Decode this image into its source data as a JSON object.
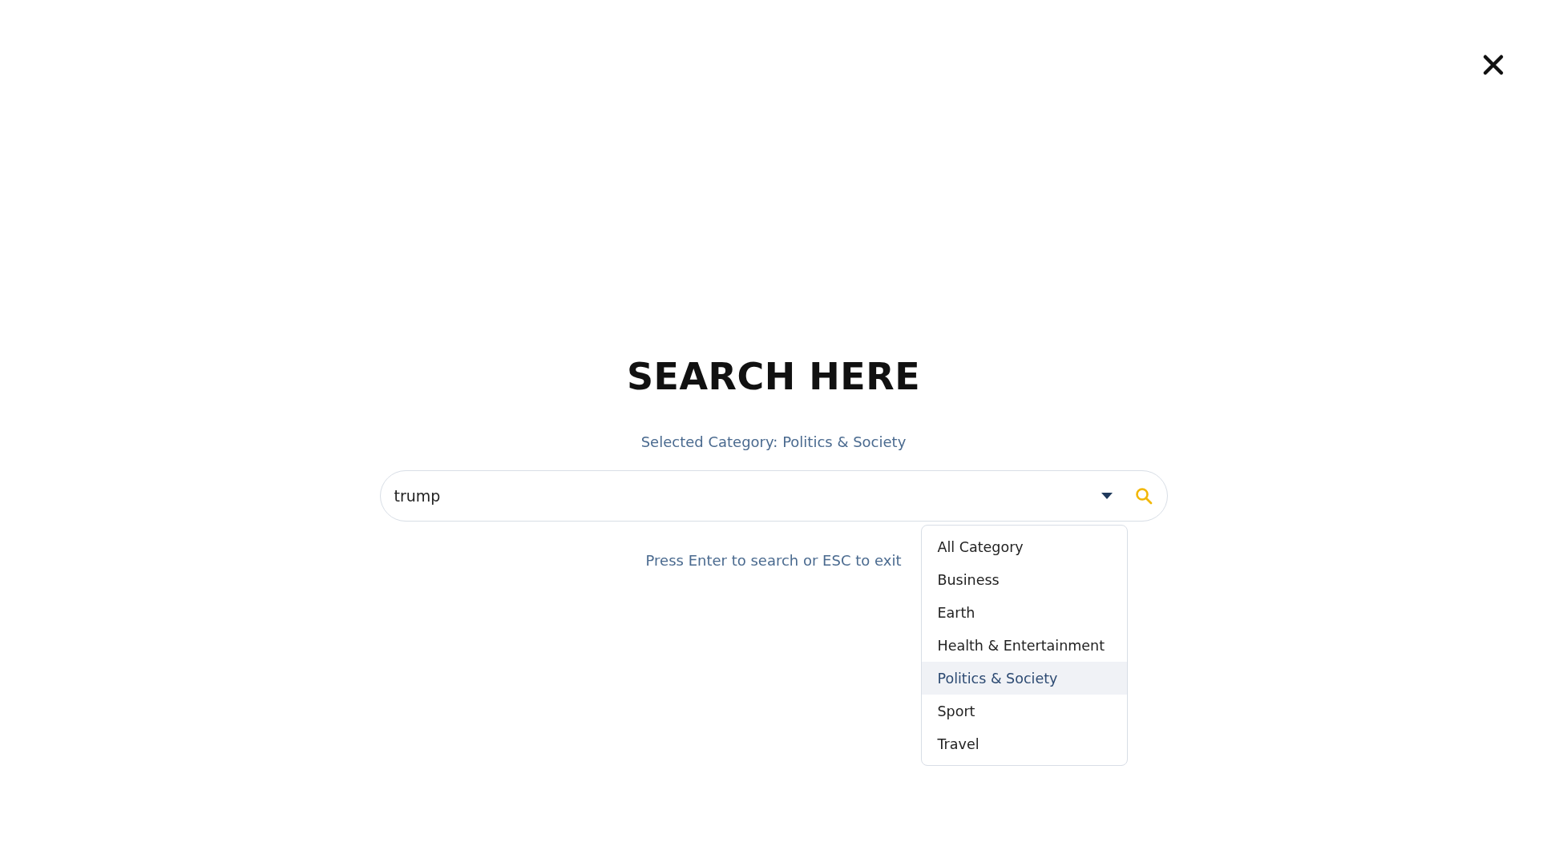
{
  "title": "SEARCH HERE",
  "selected_category": "Selected Category: Politics & Society",
  "search": {
    "value": "trump"
  },
  "hint": "Press Enter to search or ESC to exit",
  "category_menu": {
    "expanded": true,
    "items": [
      {
        "label": "All Category",
        "selected": false
      },
      {
        "label": "Business",
        "selected": false
      },
      {
        "label": "Earth",
        "selected": false
      },
      {
        "label": "Health & Entertainment",
        "selected": false
      },
      {
        "label": "Politics & Society",
        "selected": true
      },
      {
        "label": "Sport",
        "selected": false
      },
      {
        "label": "Travel",
        "selected": false
      }
    ]
  }
}
